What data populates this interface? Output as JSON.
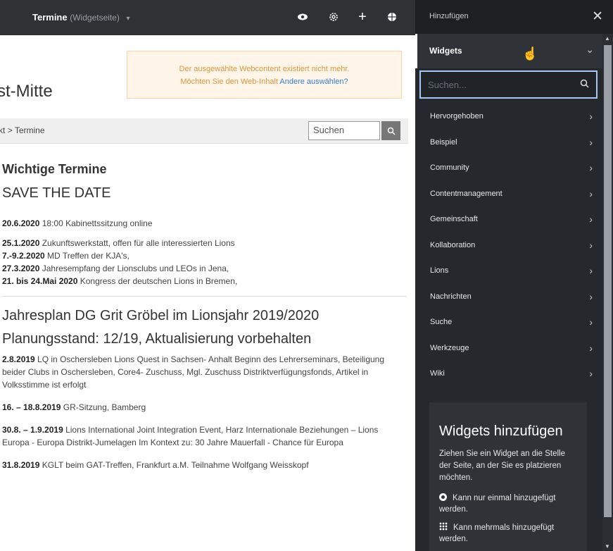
{
  "topbar": {
    "title": "Termine",
    "subtitle": "(Widgetseite)",
    "icons": [
      "eye-icon",
      "gear-icon",
      "plus-icon",
      "globe-icon"
    ]
  },
  "alert": {
    "line1": "Der ausgewählte Webcontent existiert nicht mehr.",
    "line2_prefix": "Möchten Sie den Web-Inhalt",
    "line2_link": "Andere auswählen?"
  },
  "site_title": "st-Mitte",
  "breadcrumb": {
    "parent": "kt",
    "separator": ">",
    "current": "Termine"
  },
  "search": {
    "placeholder": "Suchen"
  },
  "content": {
    "heading1": "Wichtige Termine",
    "heading2": "SAVE THE DATE",
    "block1": [
      {
        "date": "20.6.2020",
        "text": " 18:00 Kabinettssitzung online"
      }
    ],
    "block2": [
      {
        "date": "25.1.2020",
        "text": " Zukunftswerkstatt, offen für alle interessierten Lions"
      },
      {
        "date": "7.-9.2.2020",
        "text": " MD Treffen der KJA's,"
      },
      {
        "date": "27.3.2020",
        "text": " Jahresempfang der Lionsclubs und LEOs in Jena,"
      },
      {
        "date": "21. bis 24.Mai 2020",
        "text": " Kongress der deutschen Lions in Bremen,"
      }
    ],
    "heading3": "Jahresplan DG Grit Gröbel im Lionsjahr 2019/2020",
    "heading4": "Planungsstand: 12/19, Aktualisierung vorbehalten",
    "entries": [
      {
        "date": "2.8.2019",
        "text": " LQ in Oschersleben Lions Quest in Sachsen- Anhalt Beginn des Lehrerseminars, Beteiligung beider Clubs in Oschersleben, Core4- Zuschuss, Mgl. Zuschuss Distriktverfügungsfonds, Artikel in Volksstimme ist erfolgt"
      },
      {
        "date": "16. – 18.8.2019",
        "text": " GR-Sitzung, Bamberg"
      },
      {
        "date": "30.8. – 1.9.2019",
        "text": " Lions International Joint Integration Event, Harz Internationale Beziehungen – Lions Europa - Europa Distrikt-Jumelagen Im Kontext zu: 30 Jahre Mauerfall - Chance für Europa"
      },
      {
        "date": "31.8.2019",
        "text": " KGLT beim GAT-Treffen, Frankfurt a.M. Teilnahme Wolfgang Weisskopf"
      }
    ]
  },
  "panel": {
    "header": "Hinzufügen",
    "section": "Widgets",
    "search_placeholder": "Suchen...",
    "categories": [
      "Hervorgehoben",
      "Beispiel",
      "Community",
      "Contentmanagement",
      "Gemeinschaft",
      "Kollaboration",
      "Lions",
      "Nachrichten",
      "Suche",
      "Werkzeuge",
      "Wiki"
    ],
    "info": {
      "title": "Widgets hinzufügen",
      "description": "Ziehen Sie ein Widget an die Stelle der Seite, an der Sie es platzieren möchten.",
      "once": "Kann nur einmal hinzugefügt werden.",
      "multiple": "Kann mehrmals hinzugefügt werden."
    }
  }
}
